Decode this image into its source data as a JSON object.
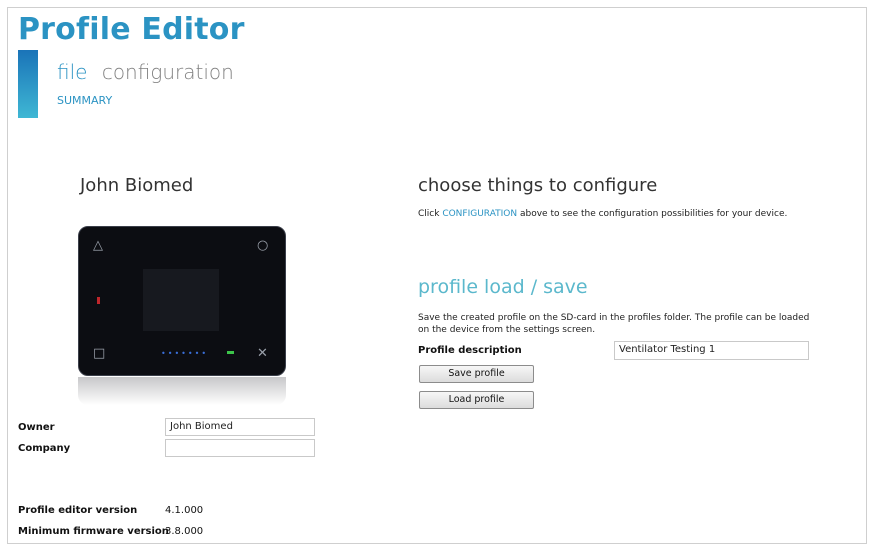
{
  "app": {
    "title": "Profile Editor"
  },
  "nav": {
    "file": "file",
    "configuration": "configuration",
    "summary": "SUMMARY"
  },
  "device": {
    "name": "John Biomed",
    "icons": [
      "triangle-icon",
      "circle-icon",
      "square-icon",
      "close-icon"
    ]
  },
  "owner": {
    "owner_label": "Owner",
    "owner_value": "John Biomed",
    "company_label": "Company",
    "company_value": ""
  },
  "versions": {
    "editor_label": "Profile editor version",
    "editor_value": "4.1.000",
    "firmware_label": "Minimum firmware version",
    "firmware_value": "3.8.000"
  },
  "configure": {
    "heading": "choose things to configure",
    "text_before": "Click ",
    "link": "CONFIGURATION",
    "text_after": " above to see the configuration possibilities for your  device."
  },
  "profile": {
    "heading": "profile load / save",
    "description": "Save the created profile on the SD-card in the profiles folder. The profile can be loaded on the device from the settings screen.",
    "desc_label": "Profile description",
    "desc_value": "Ventilator Testing 1",
    "save_label": "Save profile",
    "load_label": "Load profile"
  },
  "colors": {
    "accent": "#2b93c3",
    "heading_teal": "#5bb8cc"
  }
}
